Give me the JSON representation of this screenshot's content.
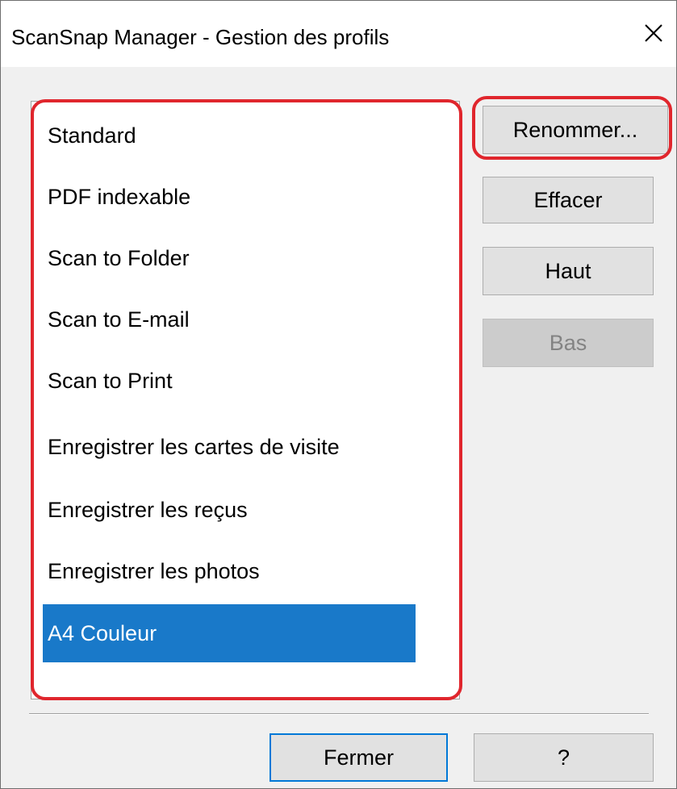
{
  "window": {
    "title": "ScanSnap Manager - Gestion des profils",
    "close_icon": "close-icon"
  },
  "profiles": {
    "items": [
      {
        "label": "Standard",
        "selected": false
      },
      {
        "label": "PDF indexable",
        "selected": false
      },
      {
        "label": "Scan to Folder",
        "selected": false
      },
      {
        "label": "Scan to E-mail",
        "selected": false
      },
      {
        "label": "Scan to Print",
        "selected": false
      },
      {
        "label": "Enregistrer les cartes de visite",
        "selected": false
      },
      {
        "label": "Enregistrer les reçus",
        "selected": false
      },
      {
        "label": "Enregistrer les photos",
        "selected": false
      },
      {
        "label": "A4 Couleur",
        "selected": true
      }
    ]
  },
  "actions": {
    "rename_label": "Renommer...",
    "delete_label": "Effacer",
    "up_label": "Haut",
    "down_label": "Bas",
    "down_enabled": false
  },
  "footer": {
    "close_label": "Fermer",
    "help_label": "?"
  },
  "colors": {
    "selection": "#1979c9",
    "highlight_annotation": "#e0262d",
    "default_button_border": "#0078d7"
  }
}
